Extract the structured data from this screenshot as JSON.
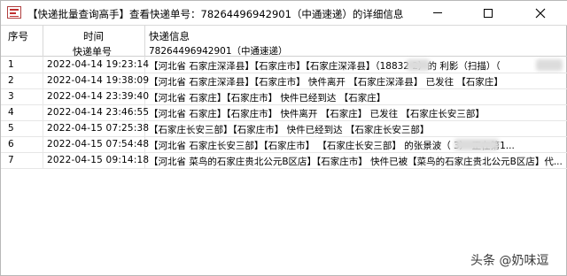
{
  "window": {
    "title": "【快递批量查询高手】查看快递单号：78264496942901（中通速递）的详细信息"
  },
  "table": {
    "header_row1": [
      "序号",
      "时间",
      "快递信息"
    ],
    "header_row2": [
      "快递单号",
      "78264496942901（中通速递）"
    ],
    "rows": [
      {
        "no": "1",
        "time": "2022-04-14 19:23:14",
        "info": "【河北省 石家庄深泽县】【石家庄市】【石家庄深泽县】（18832   2）的 利影（扫描）（"
      },
      {
        "no": "2",
        "time": "2022-04-14 19:38:09",
        "info": "【河北省 石家庄深泽县】【石家庄市】 快件离开 【石家庄深泽县】 已发往 【石家庄】"
      },
      {
        "no": "3",
        "time": "2022-04-14 23:39:40",
        "info": "【河北省 石家庄】【石家庄市】 快件已经到达 【石家庄】"
      },
      {
        "no": "4",
        "time": "2022-04-14 23:46:55",
        "info": "【河北省 石家庄】【石家庄市】 快件离开 【石家庄】 已发往 【石家庄长安三部】"
      },
      {
        "no": "5",
        "time": "2022-04-15 07:25:38",
        "info": "【石家庄长安三部】【石家庄市】 快件已经到达 【石家庄长安三部】"
      },
      {
        "no": "6",
        "time": "2022-04-15 07:54:48",
        "info": "【河北省 石家庄长安三部】【石家庄市】 【石家庄长安三部】 的张景波（   3） 正在第1..."
      },
      {
        "no": "7",
        "time": "2022-04-15 09:14:18",
        "info": "【河北省 菜鸟的石家庄贵北公元B区店】【石家庄市】 快件已被【菜鸟的石家庄贵北公元B区店】代..."
      }
    ]
  },
  "watermark": "头条 @奶味逗"
}
